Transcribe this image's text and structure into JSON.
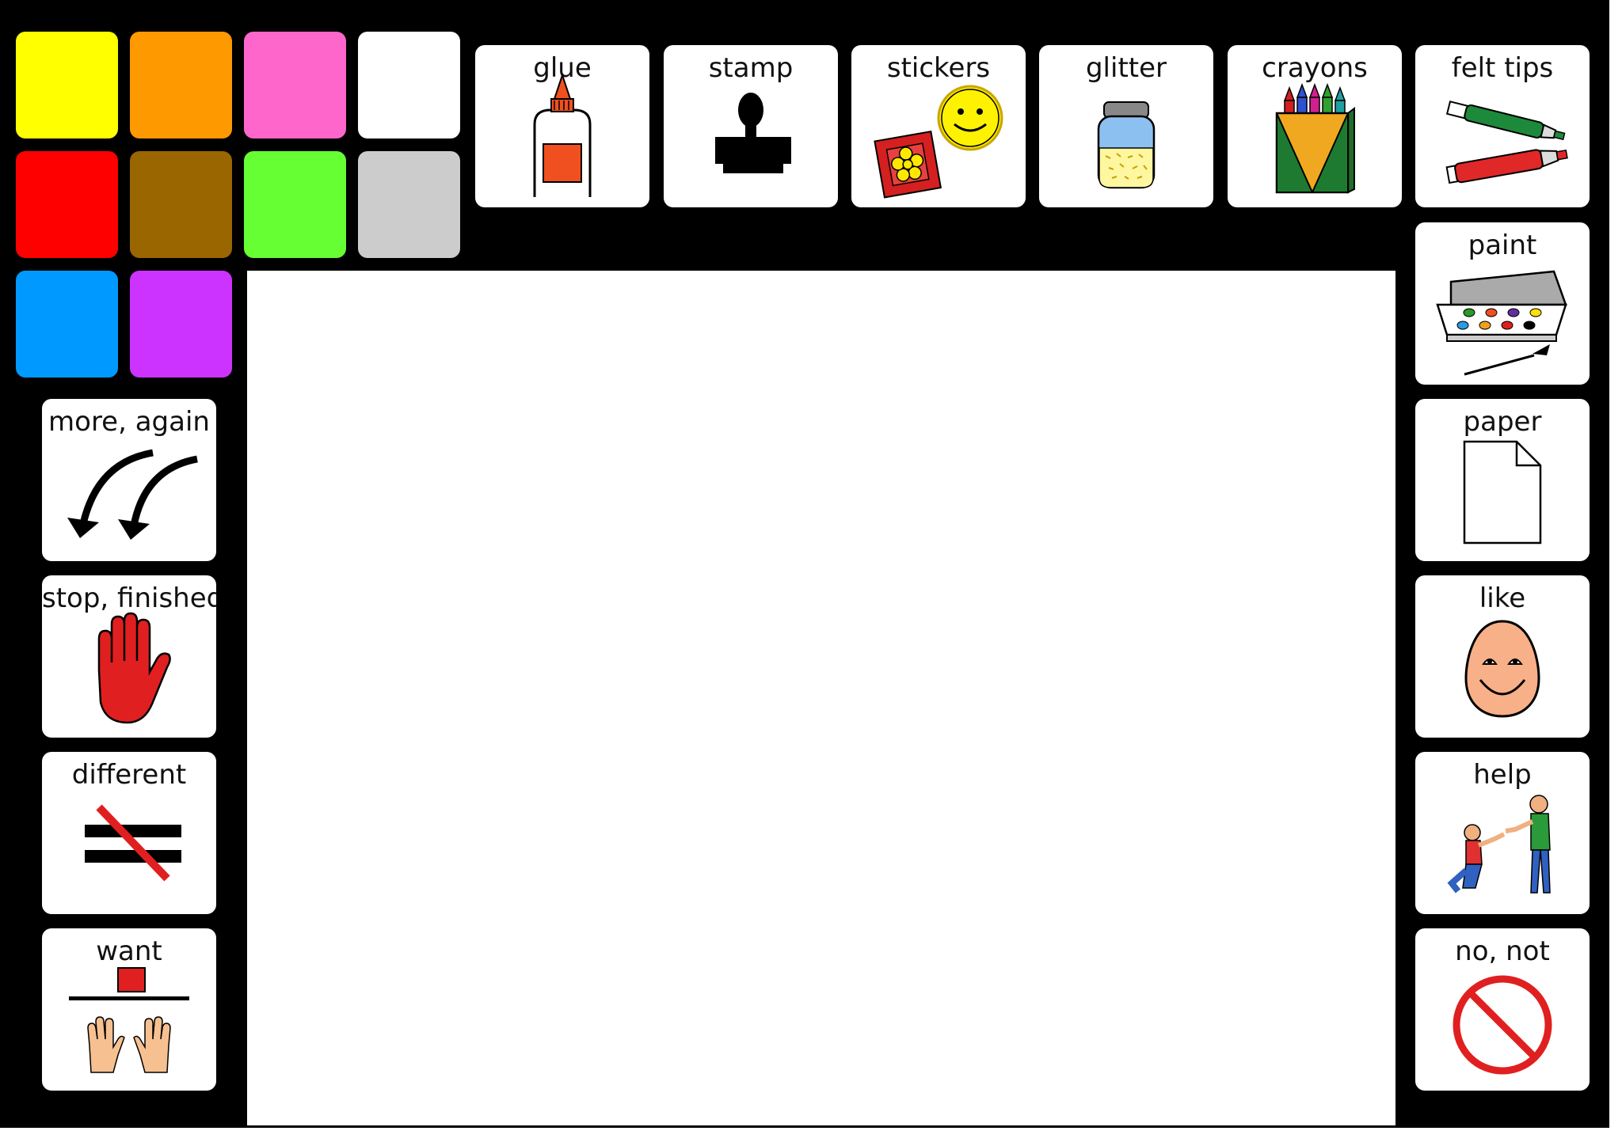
{
  "palette": {
    "swatches": [
      {
        "name": "yellow",
        "color": "#FFFF00"
      },
      {
        "name": "orange",
        "color": "#FF9900"
      },
      {
        "name": "pink",
        "color": "#FF66CC"
      },
      {
        "name": "white",
        "color": "#FFFFFF"
      },
      {
        "name": "red",
        "color": "#FF0000"
      },
      {
        "name": "brown",
        "color": "#996600"
      },
      {
        "name": "green",
        "color": "#66FF33"
      },
      {
        "name": "grey",
        "color": "#CCCCCC"
      },
      {
        "name": "blue",
        "color": "#0099FF"
      },
      {
        "name": "purple",
        "color": "#CC33FF"
      }
    ]
  },
  "tools": {
    "glue": "glue",
    "stamp": "stamp",
    "stickers": "stickers",
    "glitter": "glitter",
    "crayons": "crayons",
    "felt_tips": "felt tips"
  },
  "right_column": {
    "paint": "paint",
    "paper": "paper",
    "like": "like",
    "help": "help",
    "no_not": "no, not"
  },
  "left_column": {
    "more_again": "more, again",
    "stop_finished": "stop, finished",
    "different": "different",
    "want": "want"
  }
}
